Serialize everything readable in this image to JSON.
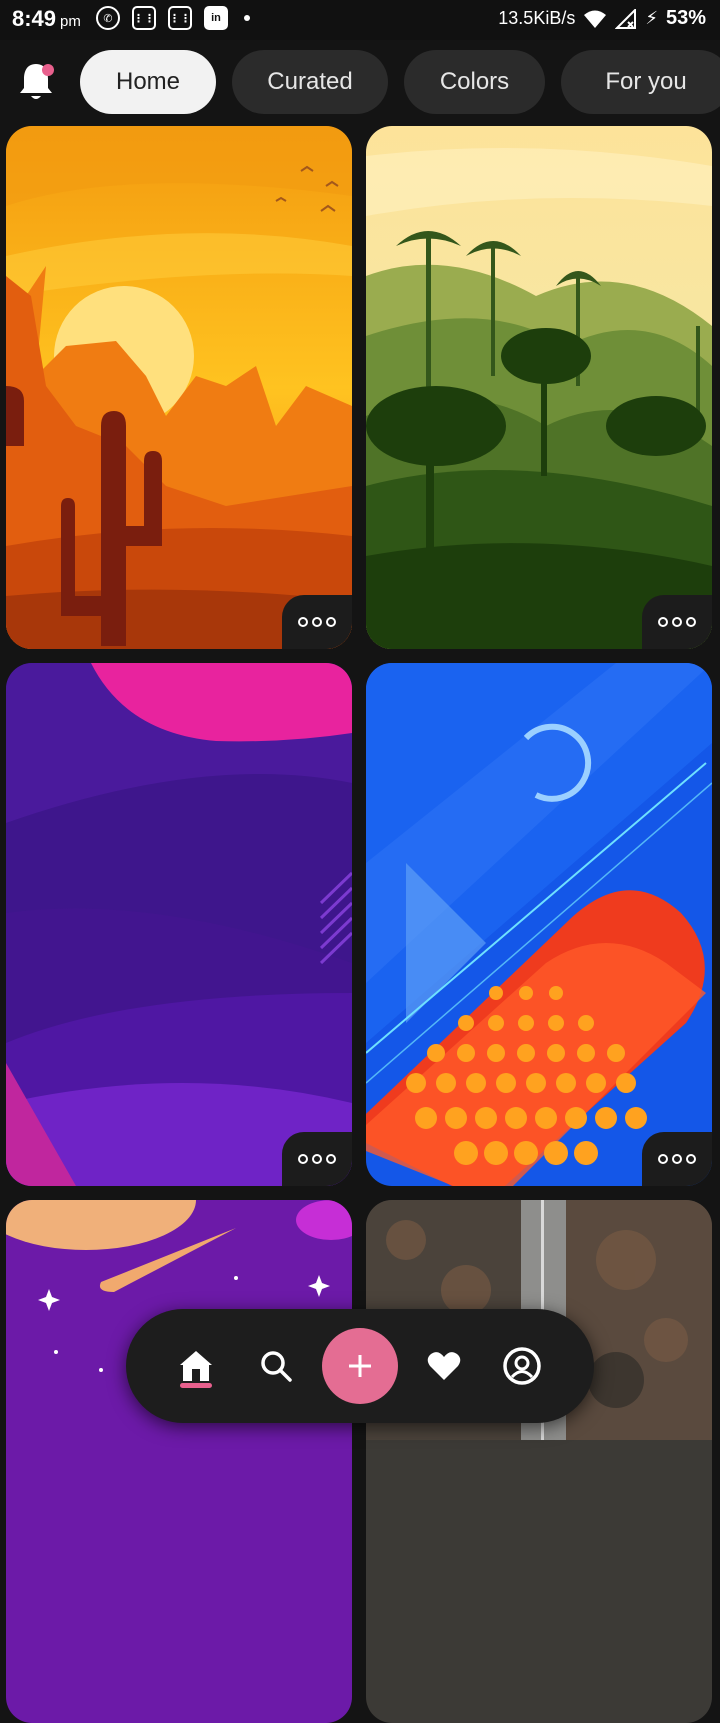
{
  "status_bar": {
    "time": "8:49",
    "ampm": "pm",
    "network_speed": "13.5KiB/s",
    "battery": "53%",
    "notification_icons": [
      "whatsapp-icon",
      "calculator-icon",
      "calculator-icon",
      "linkedin-icon"
    ],
    "linkedin_text": "in"
  },
  "top_nav": {
    "tabs": [
      {
        "label": "Home",
        "active": true
      },
      {
        "label": "Curated",
        "active": false
      },
      {
        "label": "Colors",
        "active": false
      },
      {
        "label": "For you",
        "active": false
      }
    ],
    "notification_icon": "bell-icon",
    "badge_color": "#e8608d"
  },
  "wallpapers": [
    {
      "name": "desert-sunset"
    },
    {
      "name": "jungle-silhouette"
    },
    {
      "name": "purple-waves"
    },
    {
      "name": "blue-orange-abstract"
    },
    {
      "name": "purple-space"
    },
    {
      "name": "aerial-road"
    }
  ],
  "bottom_nav": {
    "items": [
      "home-icon",
      "search-icon",
      "add-icon",
      "heart-icon",
      "profile-icon"
    ],
    "accent": "#e46d93"
  }
}
